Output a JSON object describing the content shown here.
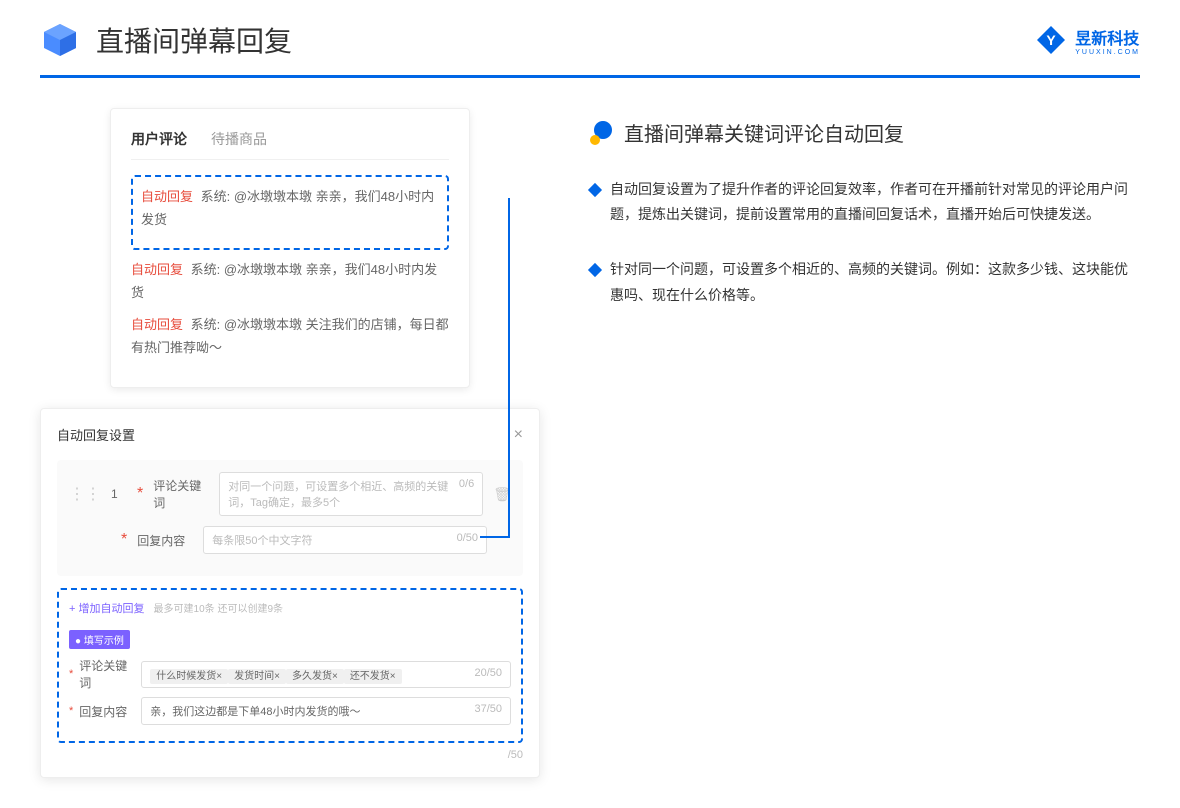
{
  "header": {
    "title": "直播间弹幕回复",
    "logo_cn": "昱新科技",
    "logo_en": "YUUXIN.COM"
  },
  "comments": {
    "tab1": "用户评论",
    "tab2": "待播商品",
    "row1_tag": "自动回复",
    "row1_text": "系统: @冰墩墩本墩 亲亲，我们48小时内发货",
    "row2_tag": "自动回复",
    "row2_text": "系统: @冰墩墩本墩 亲亲，我们48小时内发货",
    "row3_tag": "自动回复",
    "row3_text": "系统: @冰墩墩本墩 关注我们的店铺，每日都有热门推荐呦～"
  },
  "settings": {
    "title": "自动回复设置",
    "num": "1",
    "label1": "评论关键词",
    "placeholder1": "对同一个问题，可设置多个相近、高频的关键词，Tag确定，最多5个",
    "count1": "0/6",
    "label2": "回复内容",
    "placeholder2": "每条限50个中文字符",
    "count2": "0/50",
    "add_link": "+ 增加自动回复",
    "add_sub": "最多可建10条 还可以创建9条",
    "badge": "● 填写示例",
    "ex_label1": "评论关键词",
    "ex_tags": [
      "什么时候发货×",
      "发货时间×",
      "多久发货×",
      "还不发货×"
    ],
    "ex_count1": "20/50",
    "ex_label2": "回复内容",
    "ex_text": "亲，我们这边都是下单48小时内发货的哦～",
    "ex_count2": "37/50",
    "footer_count": "/50"
  },
  "right": {
    "section_title": "直播间弹幕关键词评论自动回复",
    "bullet1": "自动回复设置为了提升作者的评论回复效率，作者可在开播前针对常见的评论用户问题，提炼出关键词，提前设置常用的直播间回复话术，直播开始后可快捷发送。",
    "bullet2": "针对同一个问题，可设置多个相近的、高频的关键词。例如：这款多少钱、这块能优惠吗、现在什么价格等。"
  }
}
